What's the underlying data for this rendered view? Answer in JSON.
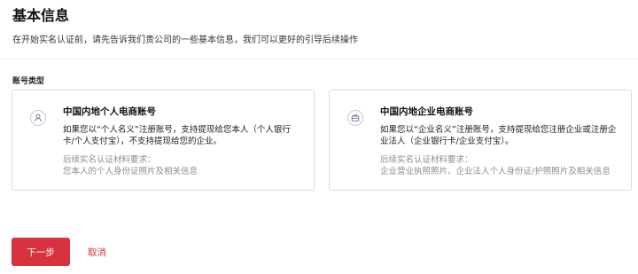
{
  "header": {
    "title": "基本信息",
    "subtitle": "在开始实名认证前，请先告诉我们贵公司的一些基本信息，我们可以更好的引导后续操作"
  },
  "section": {
    "label": "账号类型"
  },
  "cards": [
    {
      "icon": "person-icon",
      "title": "中国内地个人电商账号",
      "desc": "如果您以“个人名义”注册账号，支持提现给您本人（个人银行卡/个人支付宝），不支持提现给您的企业。",
      "req_title": "后续实名认证材料要求：",
      "req": "您本人的个人身份证照片及相关信息"
    },
    {
      "icon": "briefcase-icon",
      "title": "中国内地企业电商账号",
      "desc": "如果您以“企业名义”注册账号，支持提现给您注册企业或注册企业法人（企业银行卡/企业支付宝）。",
      "req_title": "后续实名认证材料要求：",
      "req": "企业营业执照照片、企业法人个人身份证/护照照片及相关信息"
    }
  ],
  "actions": {
    "next_label": "下一步",
    "cancel_label": "取消"
  },
  "colors": {
    "primary": "#d6323f",
    "icon_stroke": "#6b6b8a",
    "border": "#d9d9d9"
  }
}
